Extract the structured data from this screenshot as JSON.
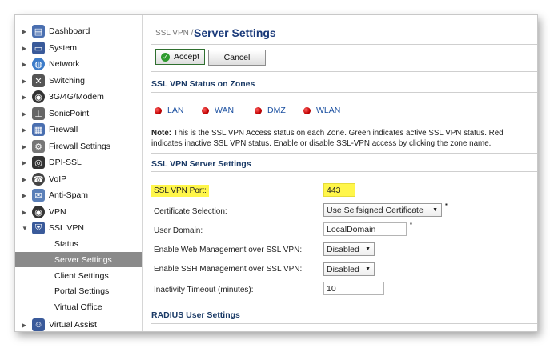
{
  "sidebar": {
    "items": [
      {
        "label": "Dashboard",
        "icon": "dashboard-icon",
        "color": "#4a6fb0"
      },
      {
        "label": "System",
        "icon": "monitor-icon",
        "color": "#3a5a9a"
      },
      {
        "label": "Network",
        "icon": "globe-icon",
        "color": "#3d7cc9"
      },
      {
        "label": "Switching",
        "icon": "switch-icon",
        "color": "#555555"
      },
      {
        "label": "3G/4G/Modem",
        "icon": "modem-icon",
        "color": "#333333"
      },
      {
        "label": "SonicPoint",
        "icon": "access-point-icon",
        "color": "#666666"
      },
      {
        "label": "Firewall",
        "icon": "firewall-icon",
        "color": "#4a6fb0"
      },
      {
        "label": "Firewall Settings",
        "icon": "firewall-settings-icon",
        "color": "#777777"
      },
      {
        "label": "DPI-SSL",
        "icon": "dpi-ssl-icon",
        "color": "#333333"
      },
      {
        "label": "VoIP",
        "icon": "voip-icon",
        "color": "#444444"
      },
      {
        "label": "Anti-Spam",
        "icon": "anti-spam-icon",
        "color": "#5a7fb8"
      },
      {
        "label": "VPN",
        "icon": "vpn-icon",
        "color": "#333333"
      },
      {
        "label": "SSL VPN",
        "icon": "ssl-vpn-icon",
        "color": "#3a5a9a"
      }
    ],
    "ssl_vpn_subitems": [
      "Status",
      "Server Settings",
      "Client Settings",
      "Portal Settings",
      "Virtual Office"
    ],
    "last_item": {
      "label": "Virtual Assist",
      "icon": "virtual-assist-icon",
      "color": "#3a5a9a"
    }
  },
  "header": {
    "breadcrumb": "SSL VPN /",
    "title": "Server Settings"
  },
  "toolbar": {
    "accept_label": "Accept",
    "cancel_label": "Cancel"
  },
  "zones_section": {
    "heading": "SSL VPN Status on Zones",
    "zones": [
      "LAN",
      "WAN",
      "DMZ",
      "WLAN"
    ],
    "status_color": "#cc0000",
    "note_bold": "Note:",
    "note_text": " This is the SSL VPN Access status on each Zone. Green indicates active SSL VPN status. Red indicates inactive SSL VPN status. Enable or disable SSL-VPN access by clicking the zone name."
  },
  "server_section": {
    "heading": "SSL VPN Server Settings",
    "port_label": "SSL VPN Port:",
    "port_value": "443",
    "cert_label": "Certificate Selection:",
    "cert_value": "Use Selfsigned Certificate",
    "domain_label": "User Domain:",
    "domain_value": "LocalDomain",
    "web_mgmt_label": "Enable Web Management over SSL VPN:",
    "web_mgmt_value": "Disabled",
    "ssh_mgmt_label": "Enable SSH Management over SSL VPN:",
    "ssh_mgmt_value": "Disabled",
    "timeout_label": "Inactivity Timeout (minutes):",
    "timeout_value": "10"
  },
  "radius_section": {
    "heading": "RADIUS User Settings"
  },
  "colors": {
    "highlight": "#fff64a",
    "title": "#1a3a7a",
    "selected_nav": "#8a8a8a"
  }
}
